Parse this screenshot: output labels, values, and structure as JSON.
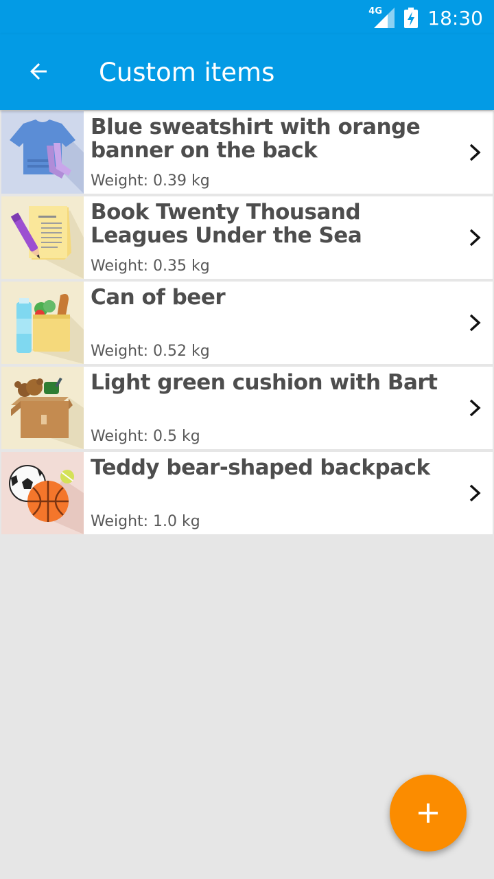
{
  "status_bar": {
    "network_label": "4G",
    "network_icon": "signal-icon",
    "battery_icon": "battery-charging-icon",
    "time": "18:30"
  },
  "app_bar": {
    "title": "Custom items",
    "back_icon": "arrow-back-icon",
    "color": "#039be5"
  },
  "items": [
    {
      "name": "Blue sweatshirt with orange banner on the back",
      "weight": "Weight: 0.39 kg",
      "icon": "clothes-icon"
    },
    {
      "name": "Book Twenty Thousand Leagues Under the Sea",
      "weight": "Weight: 0.35 kg",
      "icon": "notebook-icon"
    },
    {
      "name": "Can of beer",
      "weight": "Weight: 0.52 kg",
      "icon": "groceries-icon"
    },
    {
      "name": "Light green cushion with Bart",
      "weight": "Weight: 0.5 kg",
      "icon": "box-icon"
    },
    {
      "name": "Teddy bear-shaped backpack",
      "weight": "Weight: 1.0 kg",
      "icon": "sports-balls-icon"
    }
  ],
  "fab": {
    "icon": "add-icon",
    "color": "#fb8c00"
  }
}
